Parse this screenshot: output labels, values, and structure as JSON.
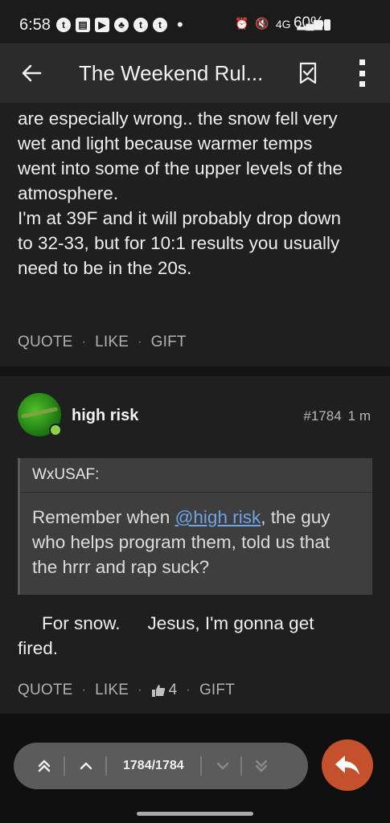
{
  "status_bar": {
    "time": "6:58",
    "network": "4G",
    "battery": "60%"
  },
  "app_bar": {
    "title": "The Weekend Rul..."
  },
  "post1": {
    "body_lines": [
      "are especially wrong.. the snow fell very",
      "wet and light because warmer temps",
      "went into some of the upper levels of the",
      "atmosphere.",
      "I'm at 39F and it will probably drop down",
      "to 32-33, but for 10:1 results you usually",
      "need to be in the 20s."
    ],
    "actions": {
      "quote": "QUOTE",
      "like": "LIKE",
      "gift": "GIFT"
    }
  },
  "post2": {
    "username": "high risk",
    "post_number": "#1784",
    "age": "1 m",
    "quote": {
      "author": "WxUSAF:",
      "line1_pre": "Remember when ",
      "mention": "@high risk",
      "line1_post": ", the guy",
      "line2": "who helps program them, told us that",
      "line3": "the hrrr and rap suck?"
    },
    "body_part1": "For snow.",
    "body_part2": "Jesus, I'm gonna get",
    "body_line2": "fired.",
    "actions": {
      "quote": "QUOTE",
      "like": "LIKE",
      "like_count": "4",
      "gift": "GIFT"
    }
  },
  "pager": {
    "position": "1784/1784"
  },
  "colors": {
    "accent": "#c4512b",
    "mention": "#6fa4e8",
    "online": "#8fd14a"
  }
}
